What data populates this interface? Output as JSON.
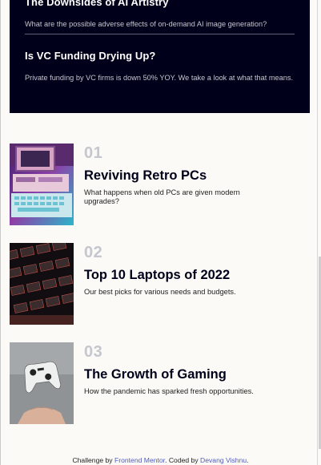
{
  "new_section": {
    "items": [
      {
        "title": "The Downsides of AI Artistry",
        "description": "What are the possible adverse effects of on-demand AI image generation?"
      },
      {
        "title": "Is VC Funding Drying Up?",
        "description": "Private funding by VC firms is down 50% YOY. We take a look at what that means."
      }
    ]
  },
  "articles": [
    {
      "number": "01",
      "title": "Reviving Retro PCs",
      "description": "What happens when old PCs are given modern upgrades?",
      "image_icon": "retro-pc-image"
    },
    {
      "number": "02",
      "title": "Top 10 Laptops of 2022",
      "description": "Our best picks for various needs and budgets.",
      "image_icon": "laptop-keyboard-image"
    },
    {
      "number": "03",
      "title": "The Growth of Gaming",
      "description": "How the pandemic has sparked fresh opportunities.",
      "image_icon": "gaming-controller-image"
    }
  ],
  "footer": {
    "prefix": "Challenge by ",
    "link1": "Frontend Mentor",
    "middle": ". Coded by ",
    "link2": "Devang Vishnu",
    "suffix": "."
  },
  "colors": {
    "dark_panel": "#00001a",
    "muted_number": "#c5c6ce",
    "page_bg": "#fbfaf6",
    "link": "#4f5bb8"
  }
}
